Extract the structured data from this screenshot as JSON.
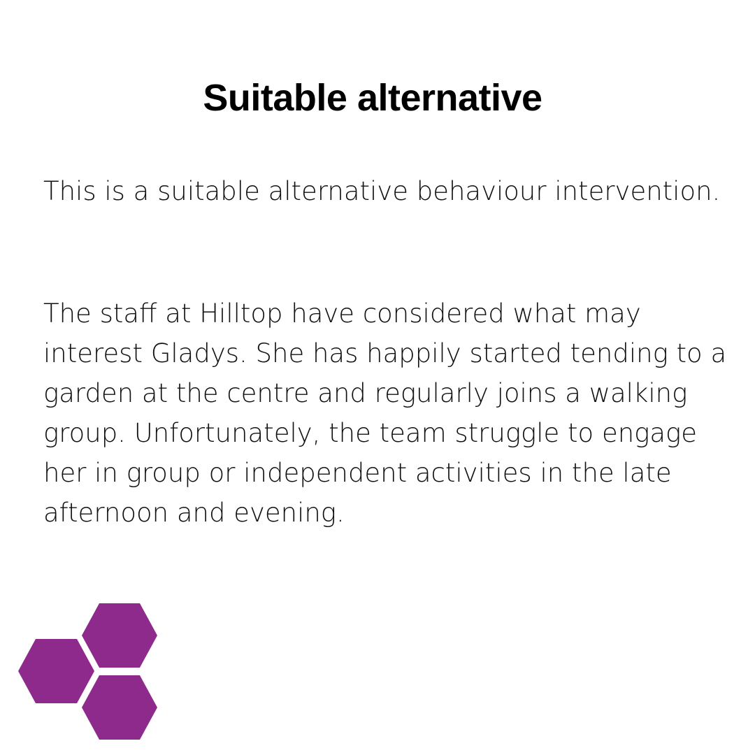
{
  "title": "Suitable alternative",
  "paragraphs": [
    "This is a suitable alternative behaviour intervention.",
    "The staff at Hilltop have considered what may interest Gladys. She has happily started tending to a garden at the centre and regularly joins a walking group. Unfortunately, the team struggle to engage her in group or independent activities in the late afternoon and evening."
  ],
  "decoration": {
    "icon": "hexagon-cluster-icon",
    "color": "#8e2a8b"
  }
}
